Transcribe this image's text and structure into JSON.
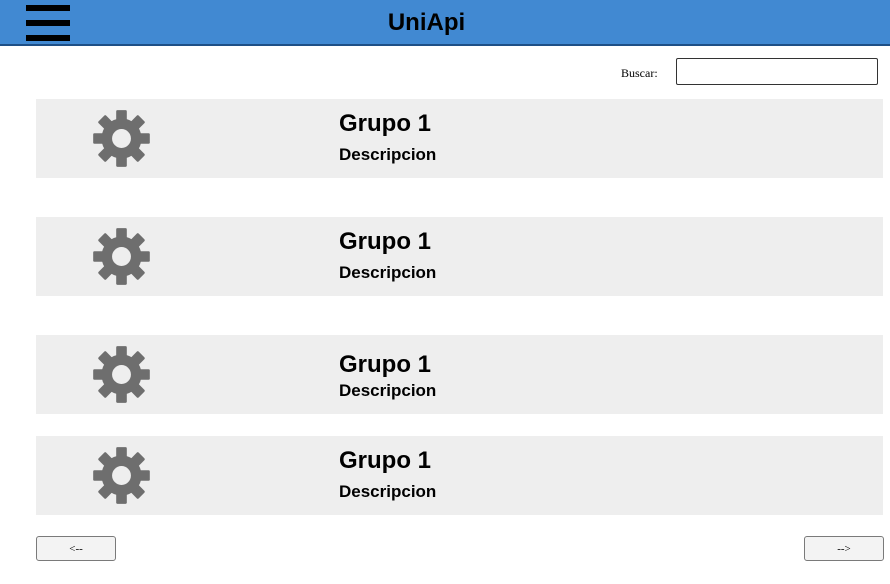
{
  "header": {
    "title": "UniApi",
    "menu_icon": "hamburger-menu-icon",
    "color": "#4189d2"
  },
  "search": {
    "label": "Buscar:",
    "value": "",
    "placeholder": ""
  },
  "groups": [
    {
      "title": "Grupo 1",
      "description": "Descripcion",
      "icon": "gear-icon"
    },
    {
      "title": "Grupo 1",
      "description": "Descripcion",
      "icon": "gear-icon"
    },
    {
      "title": "Grupo 1",
      "description": "Descripcion",
      "icon": "gear-icon"
    },
    {
      "title": "Grupo 1",
      "description": "Descripcion",
      "icon": "gear-icon"
    }
  ],
  "pagination": {
    "prev_label": "<--",
    "next_label": "-->"
  }
}
